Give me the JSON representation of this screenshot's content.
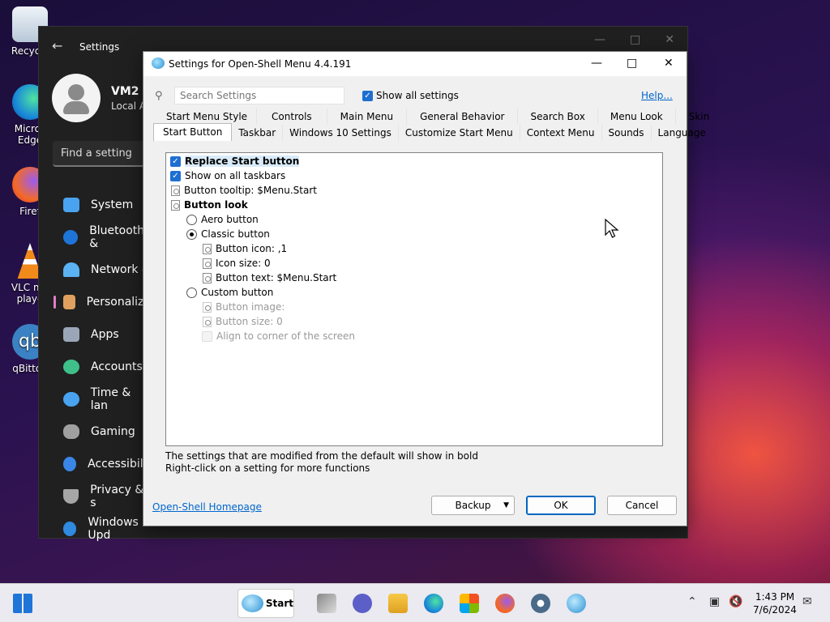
{
  "desktop": {
    "icons": [
      {
        "label": "Recycle",
        "color": "#dfe8f2"
      },
      {
        "label": "Micros Edge",
        "color": "#1a8ad8"
      },
      {
        "label": "Firef",
        "color": "#f16a2a"
      },
      {
        "label": "VLC me playe",
        "color": "#f08a1a"
      },
      {
        "label": "qBitton",
        "color": "#3b82c4"
      }
    ]
  },
  "settings_window": {
    "title": "Settings",
    "user_name": "VM2",
    "account_type": "Local A",
    "find_placeholder": "Find a setting",
    "nav": [
      {
        "label": "System",
        "color": "#4aa3f0"
      },
      {
        "label": "Bluetooth &",
        "color": "#1f74d8"
      },
      {
        "label": "Network &",
        "color": "#5ab2f2"
      },
      {
        "label": "Personaliza",
        "color": "#e0a060"
      },
      {
        "label": "Apps",
        "color": "#9aa6b8"
      },
      {
        "label": "Accounts",
        "color": "#3fc08a"
      },
      {
        "label": "Time & lan",
        "color": "#4aa3f0"
      },
      {
        "label": "Gaming",
        "color": "#a0a0a0"
      },
      {
        "label": "Accessibilit",
        "color": "#3a86e8"
      },
      {
        "label": "Privacy & s",
        "color": "#a6a6a6"
      },
      {
        "label": "Windows Upd",
        "color": "#2f8ae0"
      }
    ]
  },
  "dialog": {
    "title": "Settings for Open-Shell Menu 4.4.191",
    "search_placeholder": "Search Settings",
    "show_all_label": "Show all settings",
    "help_label": "Help...",
    "tabs_row1": [
      "Start Menu Style",
      "Controls",
      "Main Menu",
      "General Behavior",
      "Search Box",
      "Menu Look",
      "Skin"
    ],
    "tabs_row2": [
      "Start Button",
      "Taskbar",
      "Windows 10 Settings",
      "Customize Start Menu",
      "Context Menu",
      "Sounds",
      "Language"
    ],
    "settings": {
      "replace_start": "Replace Start button",
      "show_all_taskbars": "Show on all taskbars",
      "button_tooltip": "Button tooltip: $Menu.Start",
      "button_look": "Button look",
      "aero": "Aero button",
      "classic": "Classic button",
      "button_icon": "Button icon: ,1",
      "icon_size": "Icon size: 0",
      "button_text": "Button text: $Menu.Start",
      "custom": "Custom button",
      "button_image": "Button image:",
      "button_size": "Button size: 0",
      "align_corner": "Align to corner of the screen"
    },
    "note1": "The settings that are modified from the default will show in bold",
    "note2": "Right-click on a setting for more functions",
    "homepage_label": "Open-Shell Homepage",
    "backup_label": "Backup",
    "ok_label": "OK",
    "cancel_label": "Cancel"
  },
  "taskbar": {
    "start_label": "Start",
    "time": "1:43 PM",
    "date": "7/6/2024"
  }
}
